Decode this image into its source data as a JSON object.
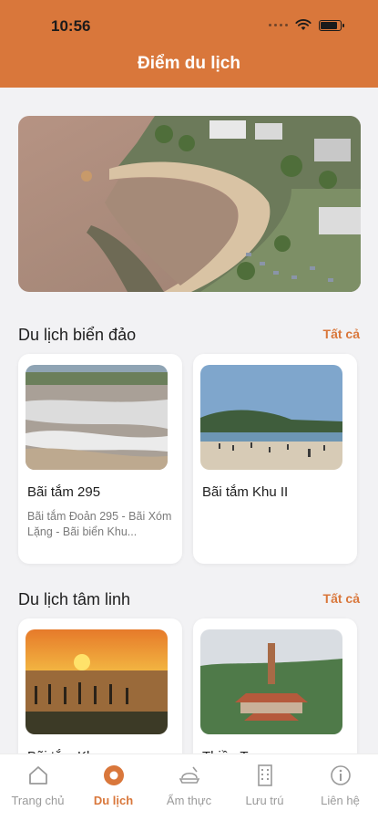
{
  "status_bar": {
    "time": "10:56",
    "battery_level": 0.9
  },
  "header": {
    "title": "Điểm du lịch"
  },
  "hero": {
    "image": "aerial-beach-photo"
  },
  "sections": [
    {
      "title": "Du lịch biển đảo",
      "see_all": "Tất cả",
      "cards": [
        {
          "name": "Bãi tắm 295",
          "desc": "Bãi tắm Đoản 295 - Bãi Xóm Lặng - Bãi biển Khu...",
          "image": "beach-waves-photo"
        },
        {
          "name": "Bãi tắm Khu II",
          "desc": "",
          "image": "beach-crowd-photo"
        }
      ]
    },
    {
      "title": "Du lịch tâm linh",
      "see_all": "Tất cả",
      "cards": [
        {
          "name": "Bãi tắm Khoang ...",
          "desc": "",
          "image": "sunset-sea-photo"
        },
        {
          "name": "Thiền Tự ...",
          "desc": "",
          "image": "pagoda-tower-photo"
        }
      ]
    }
  ],
  "tabbar": {
    "active": "Du lịch",
    "tabs": [
      {
        "label": "Trang chủ",
        "icon": "home-icon"
      },
      {
        "label": "Du lịch",
        "icon": "location-pin-icon"
      },
      {
        "label": "Ẩm thực",
        "icon": "food-icon"
      },
      {
        "label": "Lưu trú",
        "icon": "building-icon"
      },
      {
        "label": "Liên hệ",
        "icon": "info-icon"
      }
    ]
  },
  "colors": {
    "accent": "#d9773b",
    "background": "#f2f2f4",
    "card": "#ffffff"
  }
}
